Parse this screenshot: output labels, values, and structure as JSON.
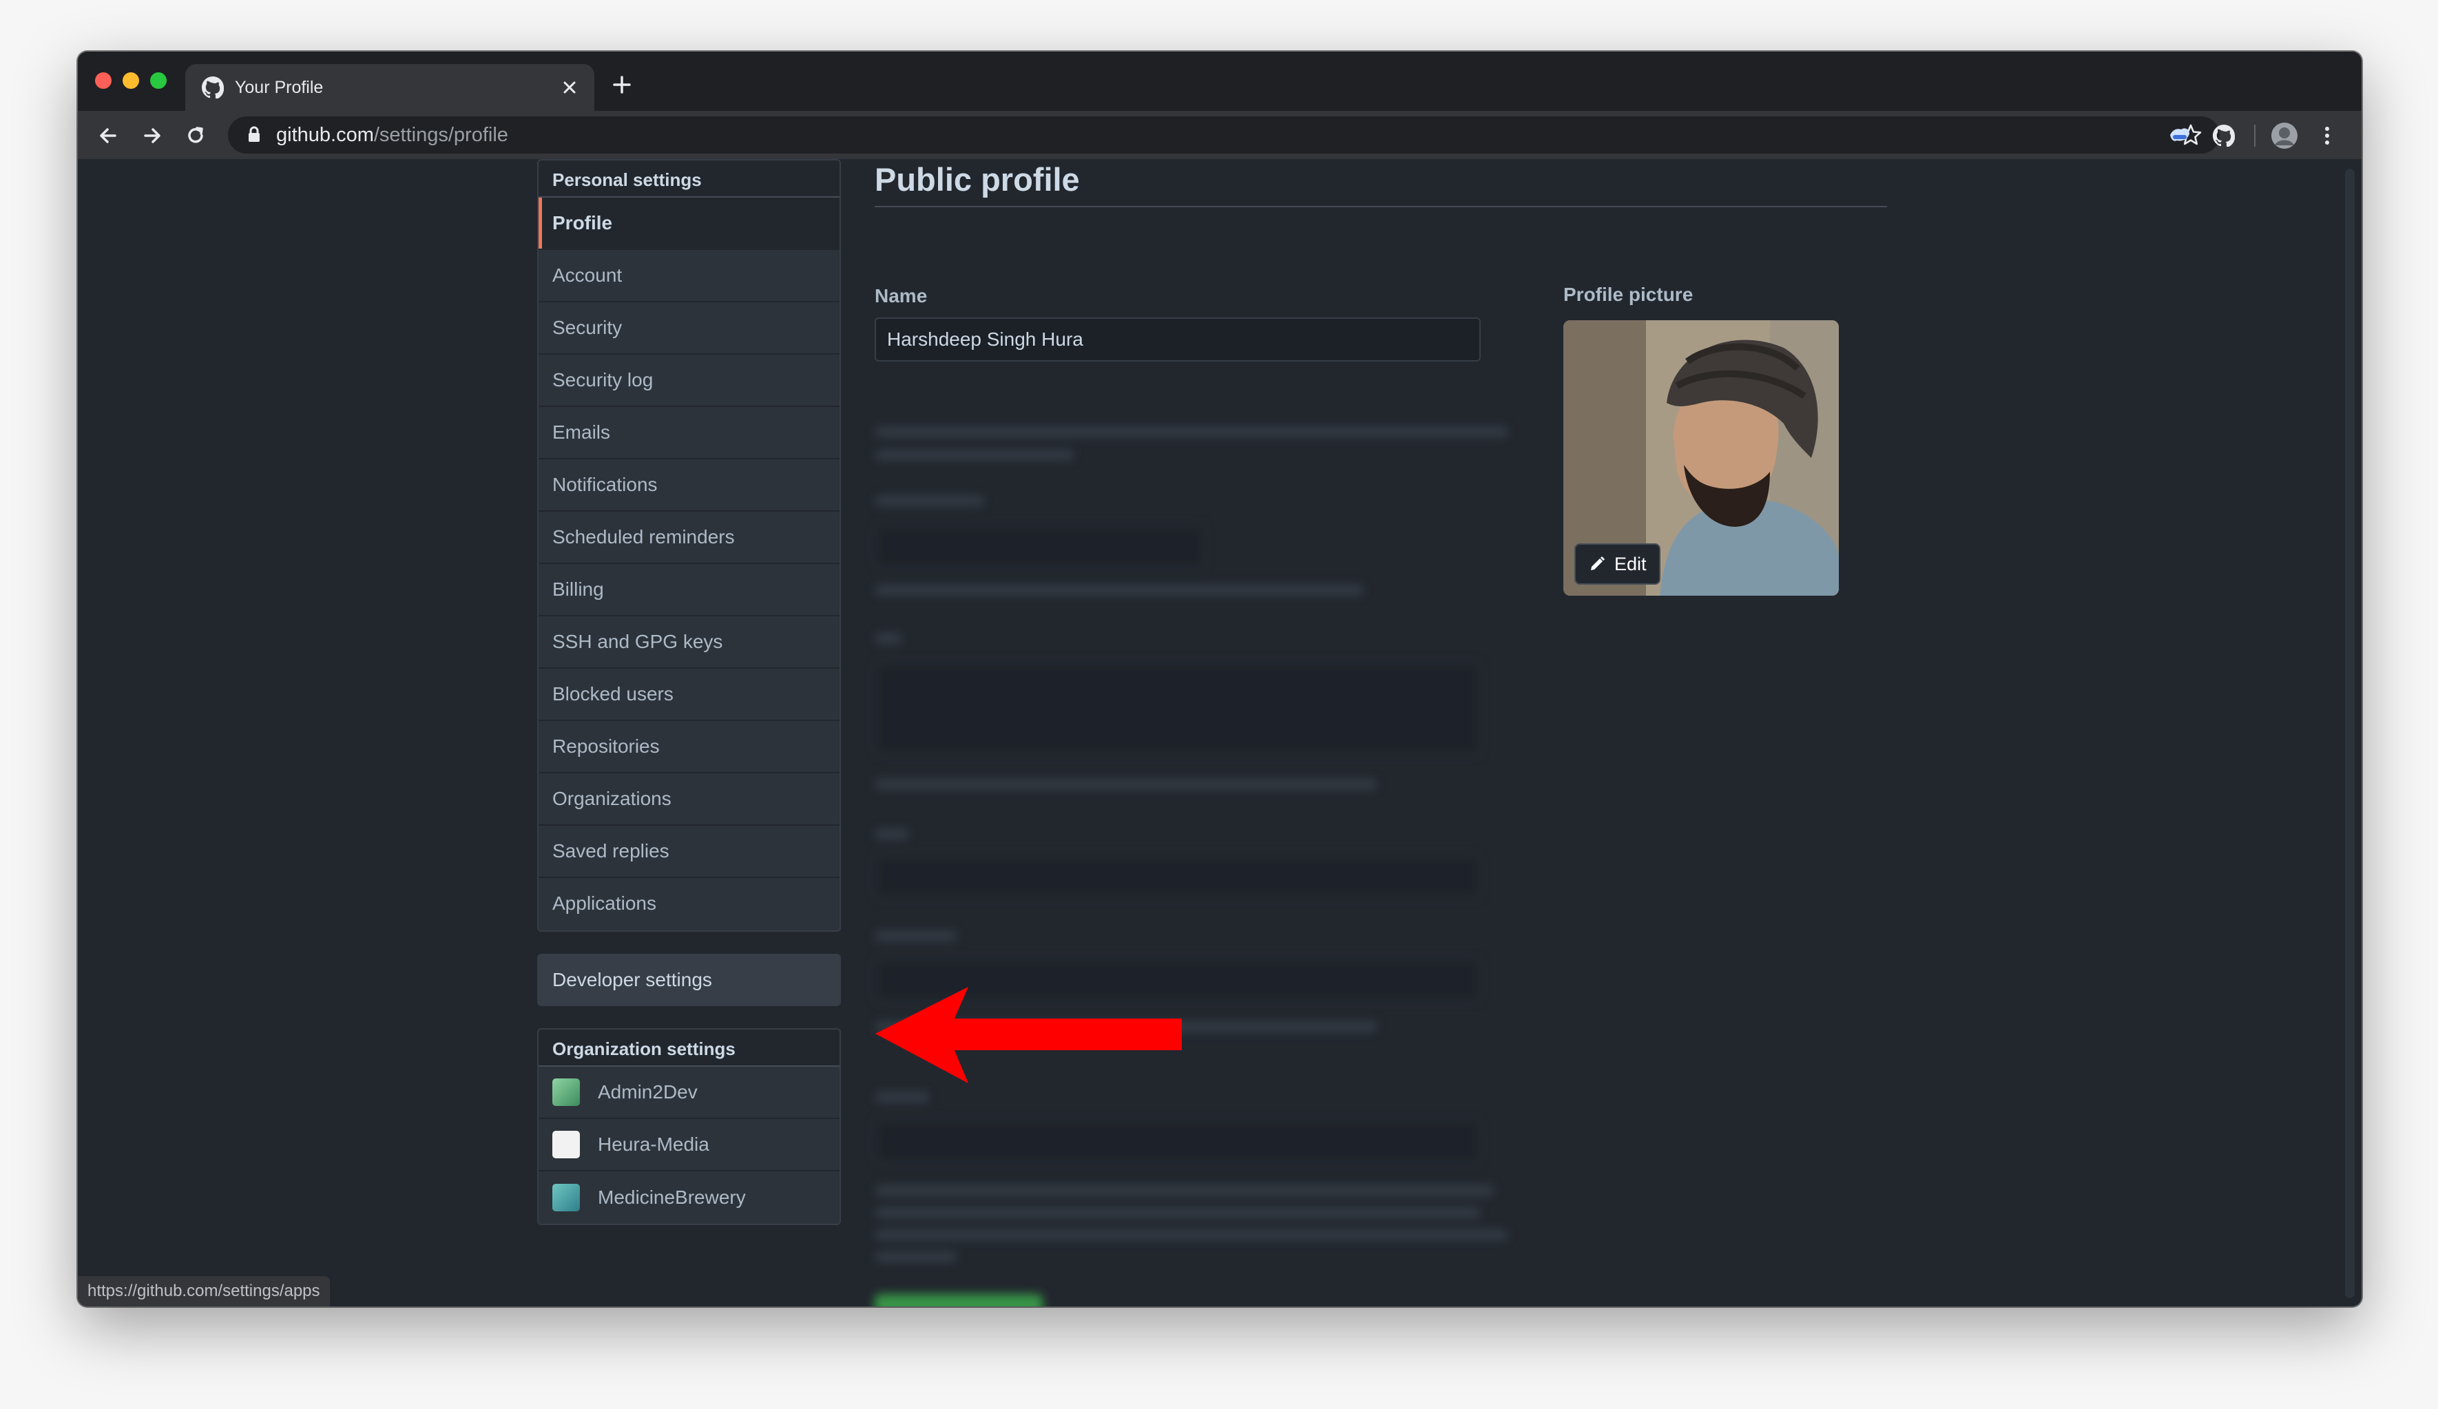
{
  "browser": {
    "tab_title": "Your Profile",
    "url_host": "github.com",
    "url_path": "/settings/profile",
    "status_url": "https://github.com/settings/apps"
  },
  "sidebar": {
    "personal_header": "Personal settings",
    "items": [
      {
        "label": "Profile",
        "selected": true
      },
      {
        "label": "Account"
      },
      {
        "label": "Security"
      },
      {
        "label": "Security log"
      },
      {
        "label": "Emails"
      },
      {
        "label": "Notifications"
      },
      {
        "label": "Scheduled reminders"
      },
      {
        "label": "Billing"
      },
      {
        "label": "SSH and GPG keys"
      },
      {
        "label": "Blocked users"
      },
      {
        "label": "Repositories"
      },
      {
        "label": "Organizations"
      },
      {
        "label": "Saved replies"
      },
      {
        "label": "Applications"
      }
    ],
    "developer_settings": "Developer settings",
    "org_header": "Organization settings",
    "orgs": [
      {
        "name": "Admin2Dev"
      },
      {
        "name": "Heura-Media"
      },
      {
        "name": "MedicineBrewery"
      }
    ]
  },
  "main": {
    "title": "Public profile",
    "name_label": "Name",
    "name_value": "Harshdeep Singh Hura",
    "picture_label": "Profile picture",
    "edit_label": "Edit"
  },
  "colors": {
    "background": "#22272e",
    "selected_accent": "#ec775c",
    "annotation_arrow": "#ff0000"
  }
}
